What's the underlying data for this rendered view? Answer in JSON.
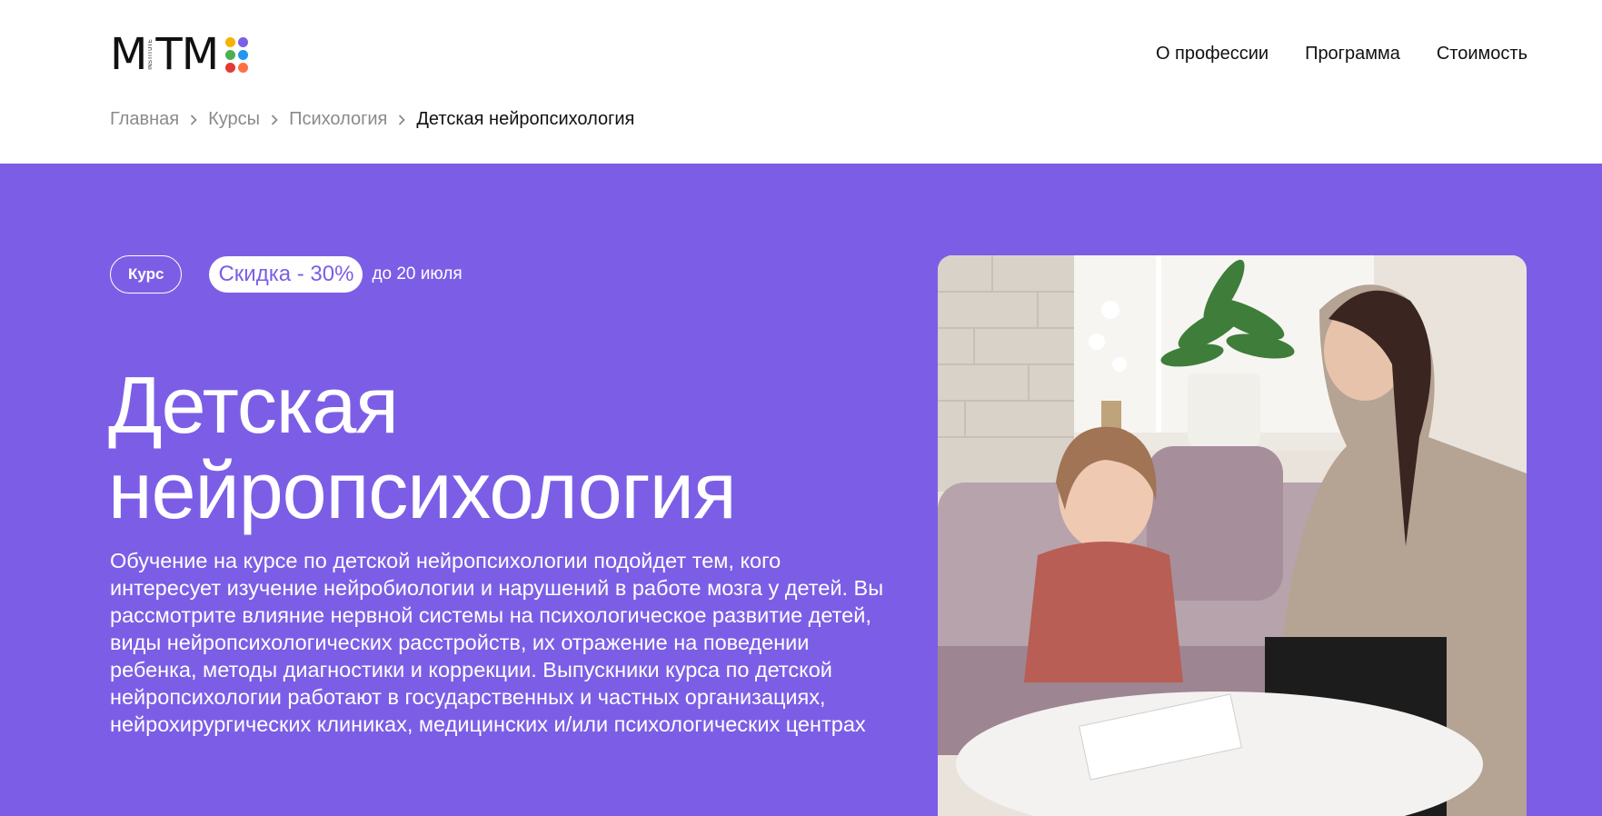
{
  "logo": {
    "letters": [
      "M",
      "T",
      "M"
    ],
    "institute": "INSTITUTE",
    "dot_colors": [
      "#f4b400",
      "#7c5ee6",
      "#4caf50",
      "#2196f3",
      "#e53935",
      "#ff7043"
    ]
  },
  "nav": {
    "items": [
      "О профессии",
      "Программа",
      "Стоимость"
    ]
  },
  "breadcrumb": {
    "items": [
      "Главная",
      "Курсы",
      "Психология"
    ],
    "current": "Детская нейропсихология"
  },
  "hero": {
    "background": "#7c5ee6",
    "tag_course": "Курс",
    "tag_sale": "Скидка - 30%",
    "tag_date": "до 20 июля",
    "title_line1": "Детская",
    "title_line2": "нейропсихология",
    "description": "Обучение на курсе по детской нейропсихологии подойдет тем, кого интересует изучение нейробиологии и нарушений в работе мозга у детей. Вы рассмотрите влияние нервной системы на психологическое развитие детей, виды нейропсихологических расстройств, их отражение на поведении ребенка, методы диагностики и коррекции. Выпускники курса по детской нейропсихологии работают в государственных и частных организациях, нейрохирургических клиниках, медицинских и/или психологических центрах"
  }
}
